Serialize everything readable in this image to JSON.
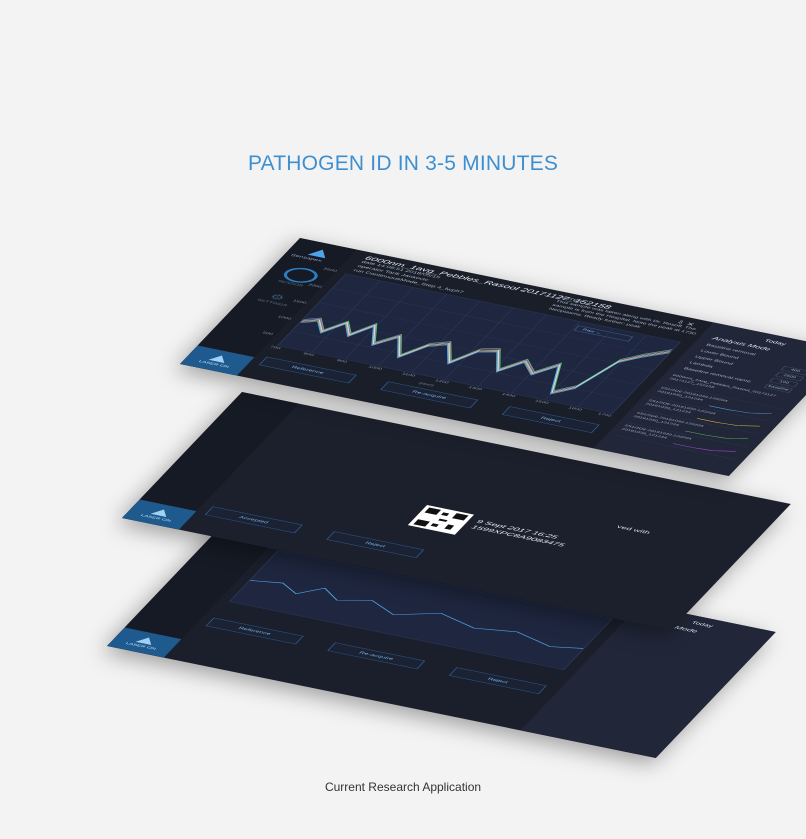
{
  "headline": "PATHOGEN ID IN 3-5 MINUTES",
  "caption": "Current Research Application",
  "app": {
    "brand": "Sensapex",
    "laser_button": "LASER ON",
    "sidebar_ring_label": "SENSOR",
    "sidebar_gear_label": "SETTINGS",
    "sample_title": "6000nm_1avg_Pebbles_Rasool 20171127_152158",
    "sample_meta": [
      "date  14:08:51 2018/05/15",
      "operator  Tarik Jankovic",
      "run  ContinuousMode_Step 4_fwp57"
    ],
    "notes_label": "NOTES",
    "notes_text": "This sample was taken along with Dr. Rosoff. The sample is from the Hospital. Note the peak at 1730. Neoplasms. Ready further: peak",
    "dropdown_label": "Raw",
    "y_ticks": [
      "2500",
      "2000",
      "1500",
      "1000",
      "500"
    ],
    "x_ticks": [
      "700",
      "800",
      "900",
      "1000",
      "1100",
      "1200",
      "1300",
      "1400",
      "1500",
      "1600",
      "1700"
    ],
    "x_axis_label": "(nm²)",
    "actions": [
      "Reference",
      "Re-acquire",
      "Reject"
    ],
    "actions_mid": [
      "Accepted",
      "Reject"
    ],
    "right_panel": {
      "today": "Today",
      "mode": "Analysis Mode",
      "params": [
        {
          "label": "Baseline removal",
          "value": ""
        },
        {
          "label": "Lower Bound",
          "value": "400"
        },
        {
          "label": "Upper Bound",
          "value": "2500"
        },
        {
          "label": "Lambda",
          "value": "100"
        },
        {
          "label": "Baseline removal name",
          "value": "baseline"
        }
      ],
      "entries": [
        {
          "title": "6000nm_1avg_Pebbles_Rasool_20171127",
          "sub": "20171127_152158",
          "color": "#4fa4e6"
        },
        {
          "title": "5S1/2D6-20181030-120204",
          "sub": "20181030_121234",
          "color": "#4fa4e6"
        },
        {
          "title": "5S1/2D6-20181030-120204",
          "sub": "20181030_121234",
          "color": "#e0b93c"
        },
        {
          "title": "5S1/2D6-20181030-120204",
          "sub": "20181030_121234",
          "color": "#5ac85a"
        },
        {
          "title": "5S1/2D6-20181030-120204",
          "sub": "20181030_121234",
          "color": "#b04fe0"
        }
      ]
    },
    "mid_text": "ved with",
    "stamp_date": "9 Sept 2017 16:25",
    "stamp_id": "1599XPC8A9083475"
  },
  "colors": {
    "accent": "#3d8fd1",
    "panel": "#1a1e2a",
    "plot": "#1f2740"
  }
}
